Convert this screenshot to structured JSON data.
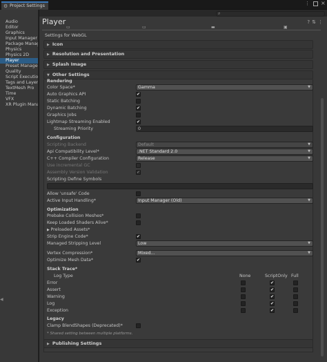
{
  "window": {
    "tab_title": "Project Settings"
  },
  "categories": [
    "Audio",
    "Editor",
    "Graphics",
    "Input Manager",
    "Package Manag",
    "Physics",
    "Physics 2D",
    "Player",
    "Preset Manager",
    "Quality",
    "Script Execution",
    "Tags and Layers",
    "TextMesh Pro",
    "Time",
    "VFX",
    "XR Plugin Manag"
  ],
  "selected_category": "Player",
  "page": {
    "title": "Player",
    "settings_for": "Settings for WebGL"
  },
  "sections": {
    "icon": "Icon",
    "resolution": "Resolution and Presentation",
    "splash": "Splash Image",
    "other": "Other Settings",
    "publishing": "Publishing Settings"
  },
  "rendering": {
    "header": "Rendering",
    "color_space_label": "Color Space*",
    "color_space_value": "Gamma",
    "auto_graphics_label": "Auto Graphics API",
    "static_batching_label": "Static Batching",
    "dynamic_batching_label": "Dynamic Batching",
    "graphics_jobs_label": "Graphics Jobs",
    "lightmap_streaming_label": "Lightmap Streaming Enabled",
    "streaming_priority_label": "Streaming Priority",
    "streaming_priority_value": "0"
  },
  "configuration": {
    "header": "Configuration",
    "scripting_backend_label": "Scripting Backend",
    "scripting_backend_value": "Default",
    "api_compat_label": "Api Compatibility Level*",
    "api_compat_value": ".NET Standard 2.0",
    "cpp_compiler_label": "C++ Compiler Configuration",
    "cpp_compiler_value": "Release",
    "incremental_gc_label": "Use incremental GC",
    "assembly_validation_label": "Assembly Version Validation",
    "define_symbols_label": "Scripting Define Symbols",
    "unsafe_code_label": "Allow 'unsafe' Code",
    "input_handling_label": "Active Input Handling*",
    "input_handling_value": "Input Manager (Old)"
  },
  "optimization": {
    "header": "Optimization",
    "prebake_label": "Prebake Collision Meshes*",
    "keep_shaders_label": "Keep Loaded Shaders Alive*",
    "preloaded_assets_label": "Preloaded Assets*",
    "strip_engine_label": "Strip Engine Code*",
    "managed_stripping_label": "Managed Stripping Level",
    "managed_stripping_value": "Low",
    "vertex_compression_label": "Vertex Compression*",
    "vertex_compression_value": "Mixed...",
    "optimize_mesh_label": "Optimize Mesh Data*"
  },
  "stack_trace": {
    "header": "Stack Trace*",
    "log_type_label": "Log Type",
    "columns": [
      "None",
      "ScriptOnly",
      "Full"
    ],
    "rows": [
      "Error",
      "Assert",
      "Warning",
      "Log",
      "Exception"
    ]
  },
  "legacy": {
    "header": "Legacy",
    "clamp_label": "Clamp BlendShapes (Deprecated)*"
  },
  "footnote": "* Shared setting between multiple platforms."
}
